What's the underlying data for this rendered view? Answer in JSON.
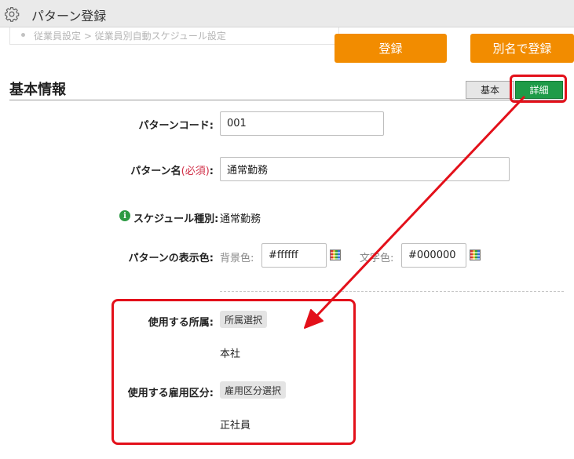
{
  "window": {
    "title": "パターン登録"
  },
  "breadcrumb": {
    "text": "従業員設定 > 従業員別自動スケジュール設定"
  },
  "actions": {
    "register": "登録",
    "save_as": "別名で登録"
  },
  "section": {
    "title": "基本情報"
  },
  "tabs": {
    "basic": "基本",
    "detail": "詳細"
  },
  "form": {
    "pattern_code": {
      "label": "パターンコード:",
      "value": "001"
    },
    "pattern_name": {
      "label_main": "パターン名",
      "label_req": "(必須)",
      "label_suffix": ":",
      "value": "通常勤務"
    },
    "schedule_type": {
      "label": "スケジュール種別:",
      "value": "通常勤務"
    },
    "display_color": {
      "label": "パターンの表示色:",
      "bg_label": "背景色:",
      "bg_value": "#ffffff",
      "text_label": "文字色:",
      "text_value": "#000000"
    },
    "department": {
      "label": "使用する所属:",
      "button": "所属選択",
      "value": "本社"
    },
    "employment_type": {
      "label": "使用する雇用区分:",
      "button": "雇用区分選択",
      "value": "正社員"
    }
  },
  "colors": {
    "accent_orange": "#f28c00",
    "tab_green": "#1e9b48",
    "highlight_red": "#e3101a"
  }
}
